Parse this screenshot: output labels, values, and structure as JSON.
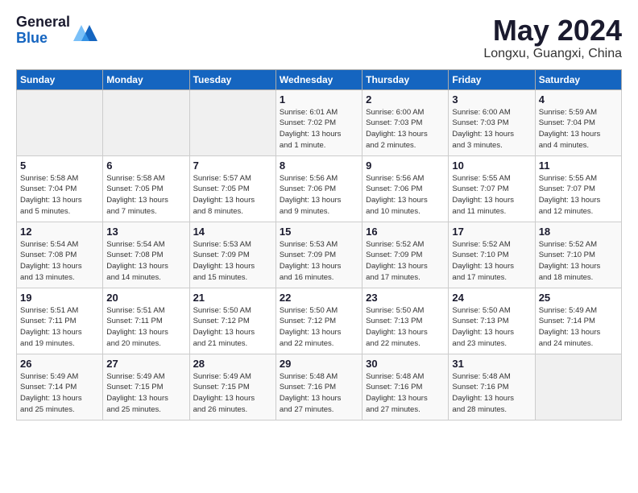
{
  "logo": {
    "general": "General",
    "blue": "Blue"
  },
  "title": "May 2024",
  "location": "Longxu, Guangxi, China",
  "days_of_week": [
    "Sunday",
    "Monday",
    "Tuesday",
    "Wednesday",
    "Thursday",
    "Friday",
    "Saturday"
  ],
  "weeks": [
    [
      {
        "day": "",
        "info": ""
      },
      {
        "day": "",
        "info": ""
      },
      {
        "day": "",
        "info": ""
      },
      {
        "day": "1",
        "info": "Sunrise: 6:01 AM\nSunset: 7:02 PM\nDaylight: 13 hours\nand 1 minute."
      },
      {
        "day": "2",
        "info": "Sunrise: 6:00 AM\nSunset: 7:03 PM\nDaylight: 13 hours\nand 2 minutes."
      },
      {
        "day": "3",
        "info": "Sunrise: 6:00 AM\nSunset: 7:03 PM\nDaylight: 13 hours\nand 3 minutes."
      },
      {
        "day": "4",
        "info": "Sunrise: 5:59 AM\nSunset: 7:04 PM\nDaylight: 13 hours\nand 4 minutes."
      }
    ],
    [
      {
        "day": "5",
        "info": "Sunrise: 5:58 AM\nSunset: 7:04 PM\nDaylight: 13 hours\nand 5 minutes."
      },
      {
        "day": "6",
        "info": "Sunrise: 5:58 AM\nSunset: 7:05 PM\nDaylight: 13 hours\nand 7 minutes."
      },
      {
        "day": "7",
        "info": "Sunrise: 5:57 AM\nSunset: 7:05 PM\nDaylight: 13 hours\nand 8 minutes."
      },
      {
        "day": "8",
        "info": "Sunrise: 5:56 AM\nSunset: 7:06 PM\nDaylight: 13 hours\nand 9 minutes."
      },
      {
        "day": "9",
        "info": "Sunrise: 5:56 AM\nSunset: 7:06 PM\nDaylight: 13 hours\nand 10 minutes."
      },
      {
        "day": "10",
        "info": "Sunrise: 5:55 AM\nSunset: 7:07 PM\nDaylight: 13 hours\nand 11 minutes."
      },
      {
        "day": "11",
        "info": "Sunrise: 5:55 AM\nSunset: 7:07 PM\nDaylight: 13 hours\nand 12 minutes."
      }
    ],
    [
      {
        "day": "12",
        "info": "Sunrise: 5:54 AM\nSunset: 7:08 PM\nDaylight: 13 hours\nand 13 minutes."
      },
      {
        "day": "13",
        "info": "Sunrise: 5:54 AM\nSunset: 7:08 PM\nDaylight: 13 hours\nand 14 minutes."
      },
      {
        "day": "14",
        "info": "Sunrise: 5:53 AM\nSunset: 7:09 PM\nDaylight: 13 hours\nand 15 minutes."
      },
      {
        "day": "15",
        "info": "Sunrise: 5:53 AM\nSunset: 7:09 PM\nDaylight: 13 hours\nand 16 minutes."
      },
      {
        "day": "16",
        "info": "Sunrise: 5:52 AM\nSunset: 7:09 PM\nDaylight: 13 hours\nand 17 minutes."
      },
      {
        "day": "17",
        "info": "Sunrise: 5:52 AM\nSunset: 7:10 PM\nDaylight: 13 hours\nand 17 minutes."
      },
      {
        "day": "18",
        "info": "Sunrise: 5:52 AM\nSunset: 7:10 PM\nDaylight: 13 hours\nand 18 minutes."
      }
    ],
    [
      {
        "day": "19",
        "info": "Sunrise: 5:51 AM\nSunset: 7:11 PM\nDaylight: 13 hours\nand 19 minutes."
      },
      {
        "day": "20",
        "info": "Sunrise: 5:51 AM\nSunset: 7:11 PM\nDaylight: 13 hours\nand 20 minutes."
      },
      {
        "day": "21",
        "info": "Sunrise: 5:50 AM\nSunset: 7:12 PM\nDaylight: 13 hours\nand 21 minutes."
      },
      {
        "day": "22",
        "info": "Sunrise: 5:50 AM\nSunset: 7:12 PM\nDaylight: 13 hours\nand 22 minutes."
      },
      {
        "day": "23",
        "info": "Sunrise: 5:50 AM\nSunset: 7:13 PM\nDaylight: 13 hours\nand 22 minutes."
      },
      {
        "day": "24",
        "info": "Sunrise: 5:50 AM\nSunset: 7:13 PM\nDaylight: 13 hours\nand 23 minutes."
      },
      {
        "day": "25",
        "info": "Sunrise: 5:49 AM\nSunset: 7:14 PM\nDaylight: 13 hours\nand 24 minutes."
      }
    ],
    [
      {
        "day": "26",
        "info": "Sunrise: 5:49 AM\nSunset: 7:14 PM\nDaylight: 13 hours\nand 25 minutes."
      },
      {
        "day": "27",
        "info": "Sunrise: 5:49 AM\nSunset: 7:15 PM\nDaylight: 13 hours\nand 25 minutes."
      },
      {
        "day": "28",
        "info": "Sunrise: 5:49 AM\nSunset: 7:15 PM\nDaylight: 13 hours\nand 26 minutes."
      },
      {
        "day": "29",
        "info": "Sunrise: 5:48 AM\nSunset: 7:16 PM\nDaylight: 13 hours\nand 27 minutes."
      },
      {
        "day": "30",
        "info": "Sunrise: 5:48 AM\nSunset: 7:16 PM\nDaylight: 13 hours\nand 27 minutes."
      },
      {
        "day": "31",
        "info": "Sunrise: 5:48 AM\nSunset: 7:16 PM\nDaylight: 13 hours\nand 28 minutes."
      },
      {
        "day": "",
        "info": ""
      }
    ]
  ]
}
